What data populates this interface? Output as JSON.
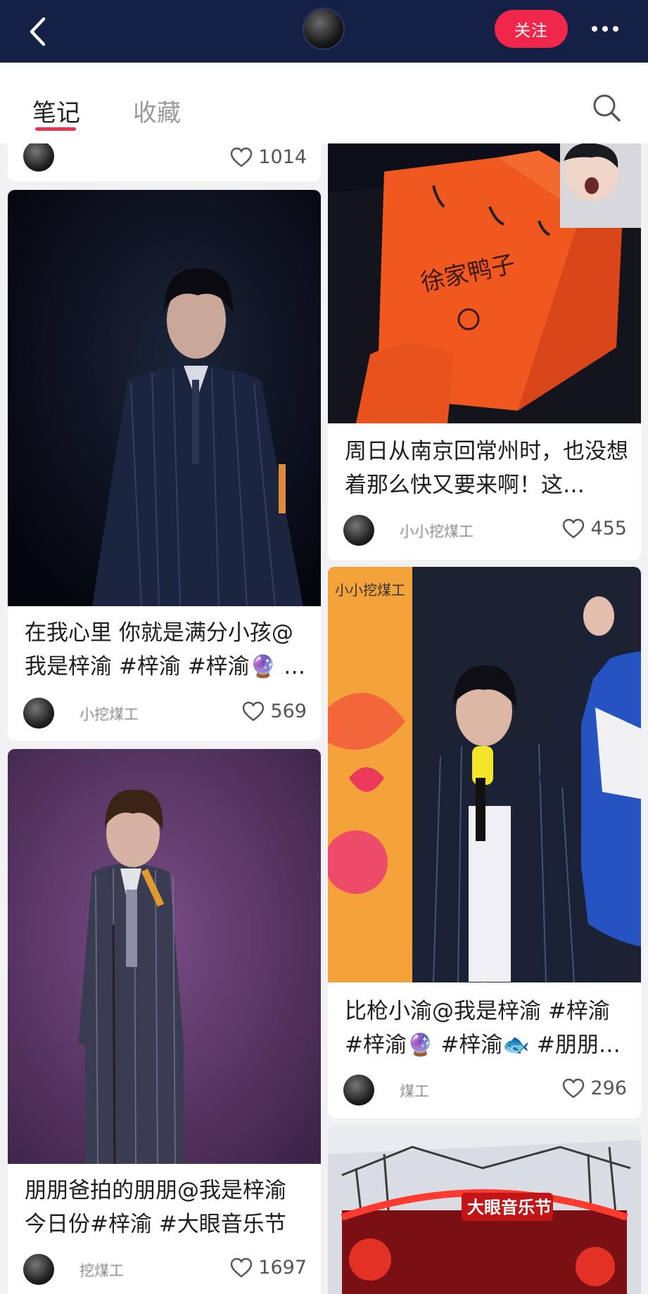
{
  "header": {
    "back_icon": "chevron-left-icon",
    "follow_label": "关注",
    "more_icon": "more-dots-icon"
  },
  "tabs": [
    {
      "label": "笔记",
      "active": true
    },
    {
      "label": "收藏",
      "active": false
    }
  ],
  "search_icon": "search-icon",
  "colors": {
    "header_bg": "#142046",
    "accent": "#f0264a",
    "tab_indicator": "#e93454"
  },
  "feed": {
    "left": [
      {
        "title": "",
        "author": "",
        "likes": "1014"
      },
      {
        "title": "在我心里 你就是满分小孩@我是梓渝 #梓渝 #梓渝🔮 …",
        "author": "小挖煤工",
        "likes": "569"
      },
      {
        "title": "朋朋爸拍的朋朋@我是梓渝 今日份#梓渝 #大眼音乐节",
        "author": "挖煤工",
        "likes": "1697"
      }
    ],
    "right": [
      {
        "title": "周日从南京回常州时，也没想着那么快又要来啊！这…",
        "author": "小小挖煤工",
        "likes": "455"
      },
      {
        "title": "比枪小渝@我是梓渝 #梓渝 #梓渝🔮 #梓渝🐟 #朋朋…",
        "author": "煤工",
        "likes": "296"
      },
      {
        "title": "",
        "author": "",
        "likes": ""
      }
    ]
  }
}
